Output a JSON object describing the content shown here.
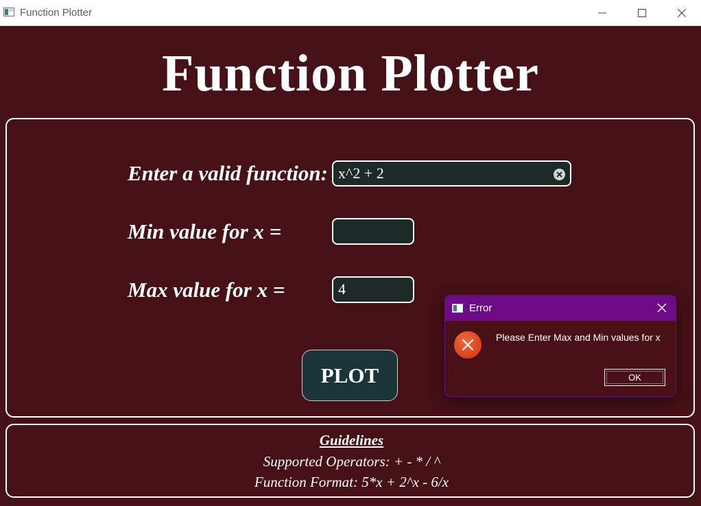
{
  "window": {
    "title": "Function Plotter",
    "icon": "app-window-icon",
    "buttons": [
      "minimize-icon",
      "maximize-icon",
      "close-icon"
    ]
  },
  "header": {
    "title": "Function Plotter"
  },
  "form": {
    "function_label": "Enter a valid function:",
    "function_value": "x^2 + 2",
    "min_label": "Min value for x =",
    "min_value": "",
    "max_label": "Max value for x =",
    "max_value": "4",
    "plot_label": "PLOT"
  },
  "dialog": {
    "title": "Error",
    "icon": "error-icon",
    "message": "Please Enter Max and Min values for x",
    "ok_label": "OK"
  },
  "guidelines": {
    "title": "Guidelines",
    "operators": "Supported Operators: + - * / ^",
    "format": "Function Format: 5*x + 2^x - 6/x"
  },
  "colors": {
    "background": "#451016",
    "field_background": "#1e2a28",
    "plot_button": "#1a3437",
    "dialog_titlebar": "#6c0a87",
    "error_icon": "#d8421a"
  }
}
